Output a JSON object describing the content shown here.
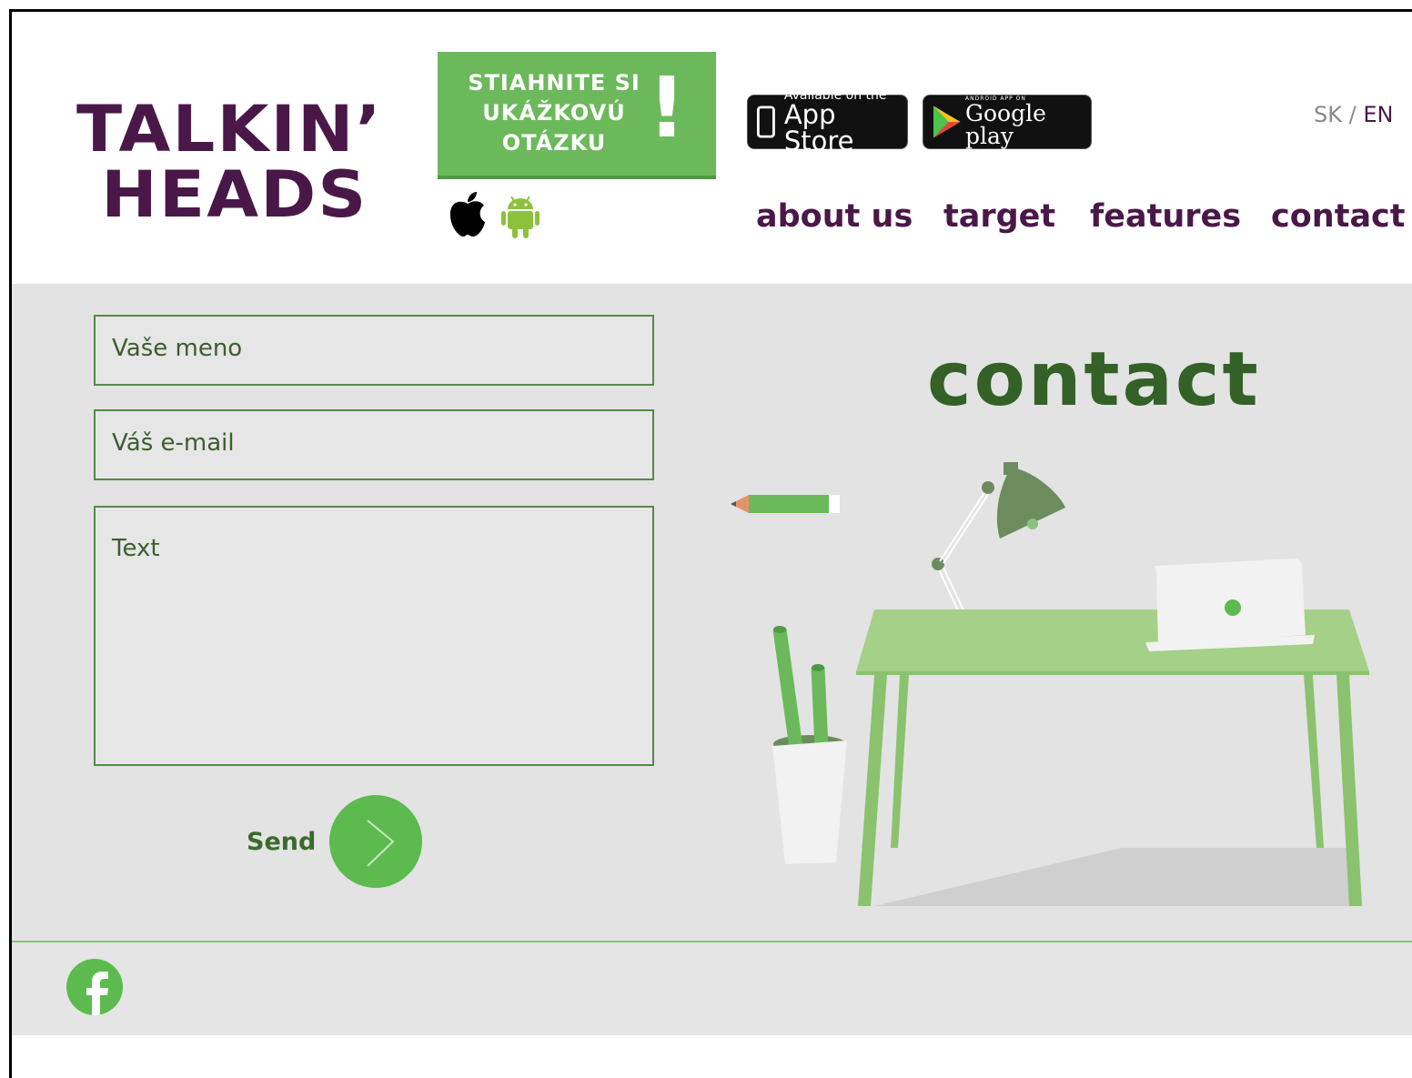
{
  "logo": {
    "line1": "TALKIN’",
    "line2": "HEADS"
  },
  "promo": {
    "lines": [
      "STIAHNITE SI",
      "UKÁŽKOVÚ",
      "OTÁZKU"
    ],
    "bang": "!"
  },
  "os_icons": [
    "apple-icon",
    "android-icon"
  ],
  "store_badges": {
    "appstore": {
      "small": "Available on the",
      "big": "App Store"
    },
    "google": {
      "small": "ANDROID APP ON",
      "big": "Google play"
    }
  },
  "lang": {
    "sk": "SK",
    "sep": " / ",
    "en": "EN"
  },
  "nav": [
    "about us",
    "target",
    "features",
    "contact"
  ],
  "form": {
    "name_placeholder": "Vaše meno",
    "email_placeholder": "Váš e-mail",
    "text_placeholder": "Text",
    "send_label": "Send"
  },
  "section_title": "contact",
  "footer": {
    "social": [
      "facebook-icon"
    ]
  },
  "colors": {
    "brand_purple": "#4a1848",
    "brand_green": "#6bb95b",
    "title_green": "#336127",
    "background_grey": "#e3e3e3"
  }
}
